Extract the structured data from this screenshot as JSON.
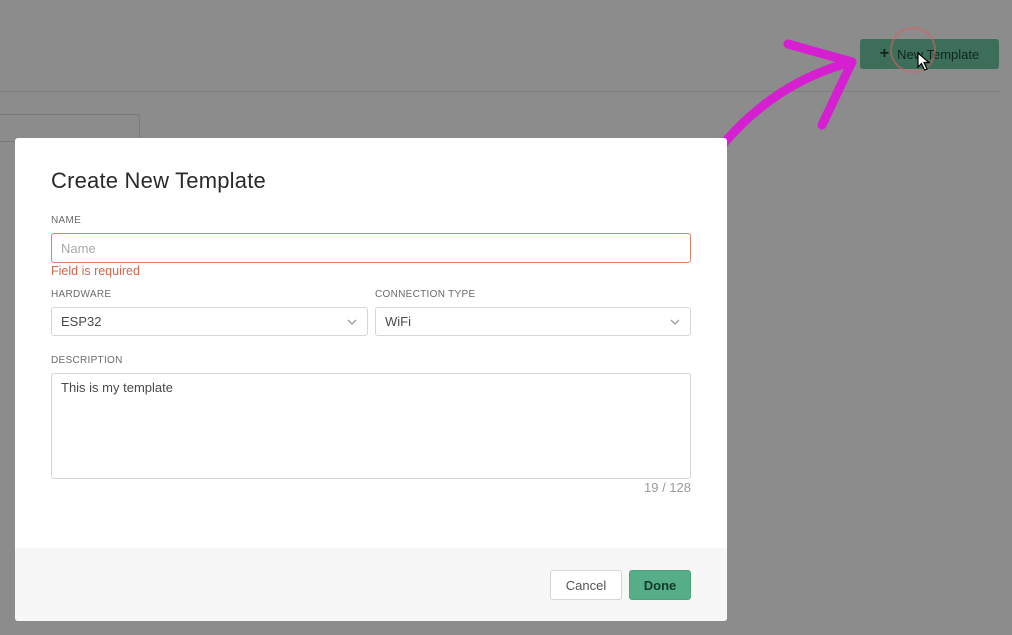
{
  "header": {
    "new_template_button": {
      "label": "New Template",
      "icon": "plus-icon"
    }
  },
  "modal": {
    "title": "Create New Template",
    "name_field": {
      "label": "NAME",
      "placeholder": "Name",
      "value": "",
      "error": "Field is required"
    },
    "hardware_field": {
      "label": "HARDWARE",
      "value": "ESP32"
    },
    "connection_field": {
      "label": "CONNECTION TYPE",
      "value": "WiFi"
    },
    "description_field": {
      "label": "DESCRIPTION",
      "value": "This is my template",
      "counter": "19 / 128"
    },
    "footer": {
      "cancel_label": "Cancel",
      "done_label": "Done"
    }
  },
  "colors": {
    "overlay": "#8c8c8c",
    "primary_button": "#55ae87",
    "error": "#d5654b",
    "annotation_arrow": "#d61fd0"
  }
}
